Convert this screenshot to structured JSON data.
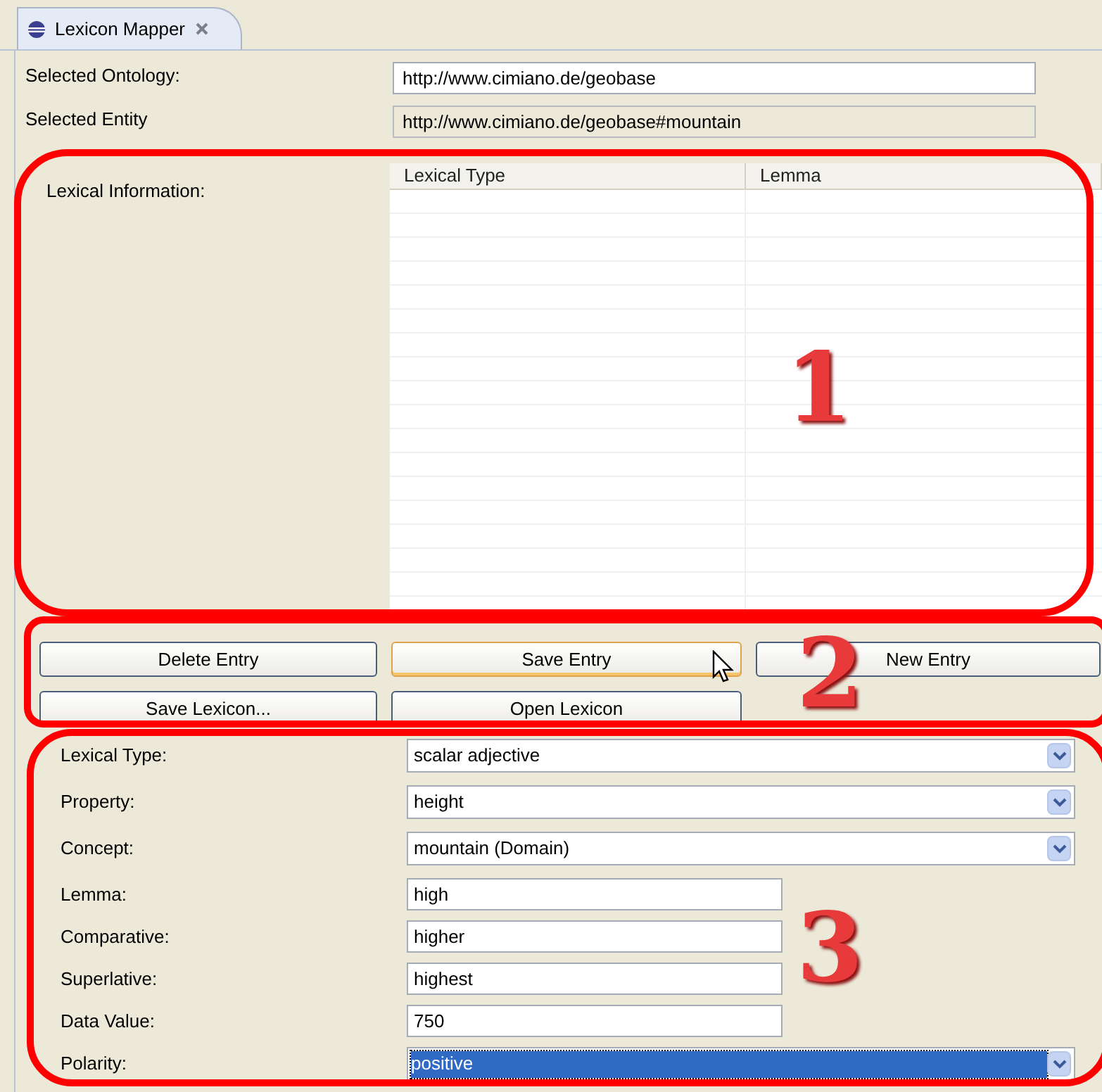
{
  "tab": {
    "title": "Lexicon Mapper"
  },
  "header_fields": [
    {
      "label": "Selected Ontology:",
      "value": "http://www.cimiano.de/geobase",
      "disabled": false
    },
    {
      "label": "Selected Entity",
      "value": "http://www.cimiano.de/geobase#mountain",
      "disabled": true
    }
  ],
  "lexical_information": {
    "label": "Lexical Information:",
    "columns": [
      "Lexical Type",
      "Lemma"
    ]
  },
  "buttons": [
    {
      "label": "Delete Entry",
      "focused": false
    },
    {
      "label": "Save Entry",
      "focused": true
    },
    {
      "label": "New Entry",
      "focused": false
    },
    {
      "label": "Save Lexicon...",
      "focused": false
    },
    {
      "label": "Open Lexicon",
      "focused": false
    }
  ],
  "form": [
    {
      "kind": "combo",
      "label": "Lexical Type:",
      "value": "scalar adjective",
      "selected": false
    },
    {
      "kind": "combo",
      "label": "Property:",
      "value": "height",
      "selected": false
    },
    {
      "kind": "combo",
      "label": "Concept:",
      "value": "mountain (Domain)",
      "selected": false
    },
    {
      "kind": "text",
      "label": "Lemma:",
      "value": "high"
    },
    {
      "kind": "text",
      "label": "Comparative:",
      "value": "higher"
    },
    {
      "kind": "text",
      "label": "Superlative:",
      "value": "highest"
    },
    {
      "kind": "text",
      "label": "Data Value:",
      "value": "750"
    },
    {
      "kind": "combo",
      "label": "Polarity:",
      "value": "positive",
      "selected": true
    }
  ],
  "annotations": [
    {
      "label": "1"
    },
    {
      "label": "2"
    },
    {
      "label": "3"
    }
  ]
}
